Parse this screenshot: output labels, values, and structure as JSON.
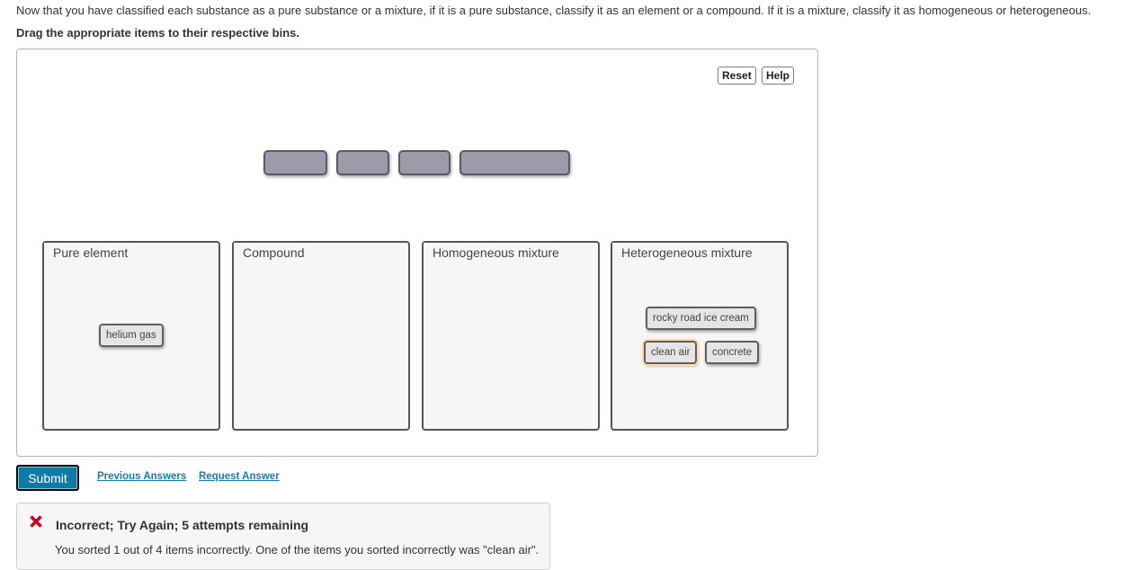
{
  "instructions": "Now that you have classified each substance as a pure substance or a mixture, if it is a pure substance, classify it as an element or a compound. If it is a mixture, classify it as homogeneous or heterogeneous.",
  "drag_instruction": "Drag the appropriate items to their respective bins.",
  "toolbar": {
    "reset_label": "Reset",
    "help_label": "Help"
  },
  "empty_slots_count": 4,
  "bins": [
    {
      "label": "Pure element",
      "items": [
        {
          "label": "helium gas",
          "state": "normal"
        }
      ]
    },
    {
      "label": "Compound",
      "items": []
    },
    {
      "label": "Homogeneous mixture",
      "items": []
    },
    {
      "label": "Heterogeneous mixture",
      "items": [
        {
          "label": "rocky road ice cream",
          "state": "normal"
        },
        {
          "label": "clean air",
          "state": "incorrect"
        },
        {
          "label": "concrete",
          "state": "normal"
        }
      ]
    }
  ],
  "actions": {
    "submit_label": "Submit",
    "previous_answers_label": "Previous Answers",
    "request_answer_label": "Request Answer"
  },
  "feedback": {
    "status": "incorrect",
    "icon": "x-mark-icon",
    "icon_color": "#d0021b",
    "title": "Incorrect; Try Again; 5 attempts remaining",
    "message": "You sorted 1 out of 4 items incorrectly. One of the items you sorted incorrectly was \"clean air\"."
  }
}
